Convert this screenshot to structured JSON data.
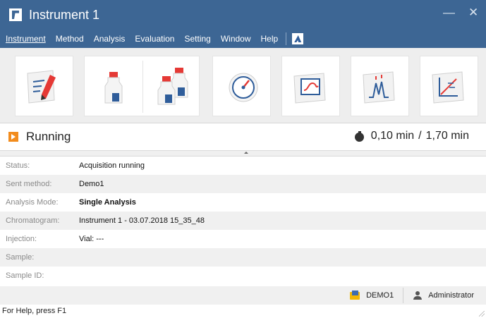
{
  "window": {
    "title": "Instrument 1",
    "minimize_glyph": "—",
    "close_glyph": "✕"
  },
  "menu": {
    "items": [
      "Instrument",
      "Method",
      "Analysis",
      "Evaluation",
      "Setting",
      "Window",
      "Help"
    ]
  },
  "toolbar": {
    "buttons": [
      {
        "icon": "edit-method-icon"
      },
      {
        "icon": "single-vial-icon"
      },
      {
        "icon": "multiple-vials-icon"
      },
      {
        "icon": "gauge-icon"
      },
      {
        "icon": "monitor-chart-icon"
      },
      {
        "icon": "chromatogram-peaks-icon"
      },
      {
        "icon": "calibration-curve-icon"
      }
    ]
  },
  "run_status": {
    "state": "Running",
    "elapsed": "0,10 min",
    "separator": "/",
    "total": "1,70 min"
  },
  "details": [
    {
      "label": "Status:",
      "value": "Acquisition running"
    },
    {
      "label": "Sent method:",
      "value": "Demo1"
    },
    {
      "label": "Analysis Mode:",
      "value": "Single Analysis"
    },
    {
      "label": "Chromatogram:",
      "value": "Instrument 1 - 03.07.2018 15_35_48"
    },
    {
      "label": "Injection:",
      "value": "Vial: ---"
    },
    {
      "label": "Sample:",
      "value": ""
    },
    {
      "label": "Sample ID:",
      "value": ""
    }
  ],
  "statusbar": {
    "project": "DEMO1",
    "user": "Administrator",
    "help_text": "For Help, press F1"
  },
  "colors": {
    "titlebar": "#3d6694",
    "accent_orange": "#f28c1d",
    "icon_blue": "#2f5d9a",
    "icon_red": "#e53935"
  }
}
